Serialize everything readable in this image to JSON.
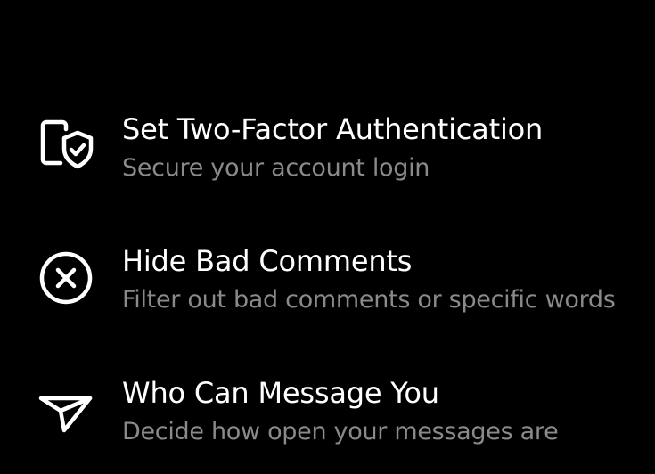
{
  "settings": {
    "items": [
      {
        "icon": "phone-shield-icon",
        "title": "Set Two-Factor Authentication",
        "subtitle": "Secure your account login"
      },
      {
        "icon": "circle-x-icon",
        "title": "Hide Bad Comments",
        "subtitle": "Filter out bad comments or specific words"
      },
      {
        "icon": "send-icon",
        "title": "Who Can Message You",
        "subtitle": "Decide how open your messages are"
      }
    ]
  },
  "colors": {
    "background": "#000000",
    "title": "#ffffff",
    "subtitle": "#8a8a8a",
    "icon": "#ffffff"
  }
}
